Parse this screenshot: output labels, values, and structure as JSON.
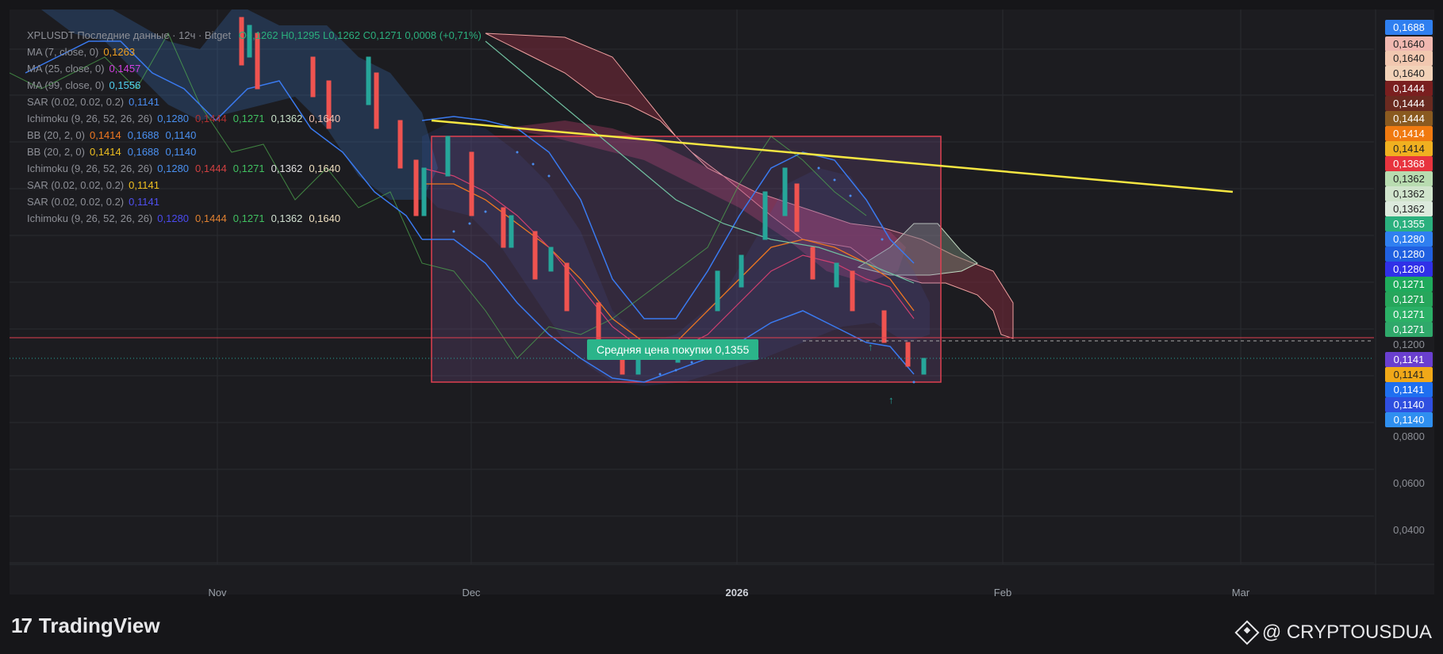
{
  "legend": {
    "header": "XPLUSDT Последние данные · 12ч · Bitget",
    "header_values": "O0,1262 H0,1295 L0,1262 C0,1271 0,0008 (+0,71%)",
    "rows": [
      {
        "label": "MA (7, close, 0)",
        "values": [
          {
            "text": "0,1263",
            "color": "#f0a020"
          }
        ]
      },
      {
        "label": "MA (25, close, 0)",
        "values": [
          {
            "text": "0,1457",
            "color": "#d040e0"
          }
        ]
      },
      {
        "label": "MA (99, close, 0)",
        "values": [
          {
            "text": "0,1556",
            "color": "#50d0f0"
          }
        ]
      },
      {
        "label": "SAR (0.02, 0.02, 0.2)",
        "values": [
          {
            "text": "0,1141",
            "color": "#4a8cf0"
          }
        ]
      },
      {
        "label": "Ichimoku (9, 26, 52, 26, 26)",
        "values": [
          {
            "text": "0,1280",
            "color": "#4a90f0"
          },
          {
            "text": "0,1444",
            "color": "#b03030"
          },
          {
            "text": "0,1271",
            "color": "#40c060"
          },
          {
            "text": "0,1362",
            "color": "#c8e0c8"
          },
          {
            "text": "0,1640",
            "color": "#f0c0b0"
          }
        ]
      },
      {
        "label": "BB (20, 2, 0)",
        "values": [
          {
            "text": "0,1414",
            "color": "#f07820"
          },
          {
            "text": "0,1688",
            "color": "#4a90f0"
          },
          {
            "text": "0,1140",
            "color": "#4a90f0"
          }
        ]
      },
      {
        "label": "BB (20, 2, 0)",
        "values": [
          {
            "text": "0,1414",
            "color": "#f0c020"
          },
          {
            "text": "0,1688",
            "color": "#4a90f0"
          },
          {
            "text": "0,1140",
            "color": "#4a90f0"
          }
        ]
      },
      {
        "label": "Ichimoku (9, 26, 52, 26, 26)",
        "values": [
          {
            "text": "0,1280",
            "color": "#4a90f0"
          },
          {
            "text": "0,1444",
            "color": "#d04040"
          },
          {
            "text": "0,1271",
            "color": "#40c060"
          },
          {
            "text": "0,1362",
            "color": "#e0e0e0"
          },
          {
            "text": "0,1640",
            "color": "#f0e0c0"
          }
        ]
      },
      {
        "label": "SAR (0.02, 0.02, 0.2)",
        "values": [
          {
            "text": "0,1141",
            "color": "#f0c020"
          }
        ]
      },
      {
        "label": "SAR (0.02, 0.02, 0.2)",
        "values": [
          {
            "text": "0,1141",
            "color": "#5050f0"
          }
        ]
      },
      {
        "label": "Ichimoku (9, 26, 52, 26, 26)",
        "values": [
          {
            "text": "0,1280",
            "color": "#4a4af0"
          },
          {
            "text": "0,1444",
            "color": "#e08030"
          },
          {
            "text": "0,1271",
            "color": "#40c060"
          },
          {
            "text": "0,1362",
            "color": "#d0e0d0"
          },
          {
            "text": "0,1640",
            "color": "#f0e0c0"
          }
        ]
      }
    ]
  },
  "price_scale": {
    "labels": [
      {
        "text": "0,1688",
        "bg": "#2f7ff0",
        "fg": "#ffffff"
      },
      {
        "text": "0,1640",
        "bg": "#f0b8b0",
        "fg": "#222222"
      },
      {
        "text": "0,1640",
        "bg": "#f2c8b0",
        "fg": "#222222"
      },
      {
        "text": "0,1640",
        "bg": "#f2d2b8",
        "fg": "#222222"
      },
      {
        "text": "0,1444",
        "bg": "#7a1f1f",
        "fg": "#ffffff"
      },
      {
        "text": "0,1444",
        "bg": "#6a2a20",
        "fg": "#ffffff"
      },
      {
        "text": "0,1444",
        "bg": "#8a5a20",
        "fg": "#ffffff"
      },
      {
        "text": "0,1414",
        "bg": "#f07a10",
        "fg": "#ffffff"
      },
      {
        "text": "0,1414",
        "bg": "#f0b020",
        "fg": "#222222"
      },
      {
        "text": "0,1368",
        "bg": "#e8343e",
        "fg": "#ffffff"
      },
      {
        "text": "0,1362",
        "bg": "#b8dcb0",
        "fg": "#222222"
      },
      {
        "text": "0,1362",
        "bg": "#d0e4cc",
        "fg": "#222222"
      },
      {
        "text": "0,1362",
        "bg": "#dceadc",
        "fg": "#222222"
      },
      {
        "text": "0,1355",
        "bg": "#2bb07e",
        "fg": "#ffffff"
      },
      {
        "text": "0,1280",
        "bg": "#2f7ff0",
        "fg": "#ffffff"
      },
      {
        "text": "0,1280",
        "bg": "#2060e0",
        "fg": "#ffffff"
      },
      {
        "text": "0,1280",
        "bg": "#3030e8",
        "fg": "#ffffff"
      },
      {
        "text": "0,1271",
        "bg": "#1faa5c",
        "fg": "#ffffff"
      },
      {
        "text": "0,1271",
        "bg": "#26a65b",
        "fg": "#ffffff"
      },
      {
        "text": "0,1271",
        "bg": "#2bb066",
        "fg": "#ffffff"
      },
      {
        "text": "0,1271",
        "bg": "#2fa86a",
        "fg": "#ffffff"
      },
      {
        "text": "0,1200",
        "bg": "transparent",
        "fg": "#8d8f96"
      },
      {
        "text": "0,1141",
        "bg": "#6a3fd0",
        "fg": "#ffffff"
      },
      {
        "text": "0,1141",
        "bg": "#f0a818",
        "fg": "#222222"
      },
      {
        "text": "0,1141",
        "bg": "#1f6ff0",
        "fg": "#ffffff"
      },
      {
        "text": "0,1140",
        "bg": "#2f4fe0",
        "fg": "#ffffff"
      },
      {
        "text": "0,1140",
        "bg": "#2f8ff0",
        "fg": "#ffffff"
      },
      {
        "text": "0,0800",
        "bg": "transparent",
        "fg": "#8d8f96"
      },
      {
        "text": "0,0600",
        "bg": "transparent",
        "fg": "#8d8f96"
      },
      {
        "text": "0,0400",
        "bg": "transparent",
        "fg": "#8d8f96"
      }
    ]
  },
  "time_axis": [
    {
      "text": "Nov",
      "bold": false
    },
    {
      "text": "Dec",
      "bold": false
    },
    {
      "text": "2026",
      "bold": true
    },
    {
      "text": "Feb",
      "bold": false
    },
    {
      "text": "Mar",
      "bold": false
    }
  ],
  "annotation": {
    "avg_price_label": "Средняя цена покупки 0,1355"
  },
  "colors": {
    "background": "#1c1c20",
    "grid": "#2a2b30",
    "bull": "#26a69a",
    "bear": "#ef5350",
    "trendline": "#f5e642",
    "box_border": "#e04050"
  },
  "footer": {
    "brand": "TradingView",
    "watermark": "@ CRYPTOUSDUA"
  }
}
